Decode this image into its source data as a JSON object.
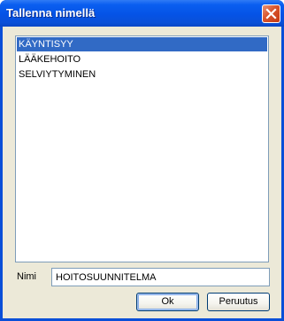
{
  "window": {
    "title": "Tallenna nimellä",
    "accent_color": "#0a50d8",
    "close_icon": "close-icon"
  },
  "list": {
    "items": [
      {
        "label": "KÄYNTISYY",
        "selected": true
      },
      {
        "label": "LÄÄKEHOITO",
        "selected": false
      },
      {
        "label": "SELVIYTYMINEN",
        "selected": false
      }
    ],
    "selection_color": "#316ac5"
  },
  "name_field": {
    "label": "Nimi",
    "value": "HOITOSUUNNITELMA"
  },
  "buttons": {
    "ok_label": "Ok",
    "cancel_label": "Peruutus"
  }
}
